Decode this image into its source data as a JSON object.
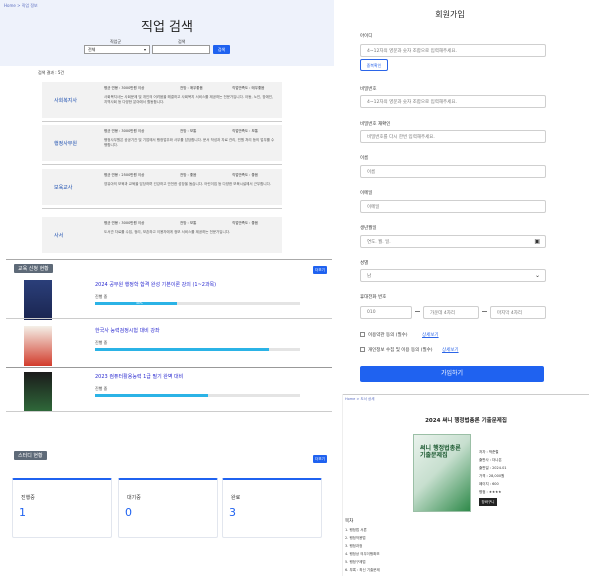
{
  "left": {
    "breadcrumb": "Home > 직업 정보",
    "hero_title": "직업 검색",
    "search": {
      "category_label": "직업군",
      "category_value": "전체",
      "keyword_label": "검색",
      "keyword_placeholder": "",
      "button": "검색"
    },
    "result_count": "검색 결과 : 5건",
    "jobs": [
      {
        "title": "사회복지사",
        "m1": "평균 연봉 : 3000만원 이상",
        "m2": "전망 : 매우좋음",
        "m3": "직업만족도 : 매우좋음",
        "desc": "사회복지사는 사회문제 및 개인의 어려움을 해결하고 사회복지 서비스를 제공하는 전문가입니다. 아동, 노인, 장애인, 지역사회 등 다양한 분야에서 활동합니다."
      },
      {
        "title": "행정사무원",
        "m1": "평균 연봉 : 3000만원 이상",
        "m2": "전망 : 보통",
        "m3": "직업만족도 : 보통",
        "desc": "행정사무원은 공공기관 및 기업에서 행정업무와 사무를 담당합니다. 문서 작성과 자료 관리, 민원 처리 등의 업무를 수행합니다."
      },
      {
        "title": "보육교사",
        "m1": "평균 연봉 : 2500만원 이상",
        "m2": "전망 : 좋음",
        "m3": "직업만족도 : 좋음",
        "desc": "영유아의 보육과 교육을 담당하며 건강하고 안전한 성장을 돕습니다. 어린이집 등 다양한 보육시설에서 근무합니다."
      },
      {
        "title": "사서",
        "m1": "평균 연봉 : 3000만원 이상",
        "m2": "전망 : 보통",
        "m3": "직업만족도 : 좋음",
        "desc": "도서관 자료를 수집, 정리, 보존하고 이용자에게 정보 서비스를 제공하는 전문가입니다."
      }
    ],
    "courses_section": {
      "title": "교육 신청 현황",
      "more": "더보기",
      "items": [
        {
          "title": "2024 공무원 행정학 합격 완성 기본이론 강의 (1~2과목)",
          "meta": "진행 중",
          "progress": 40
        },
        {
          "title": "한국사 능력검정시험 대비 강좌",
          "meta": "진행 중",
          "progress": 80
        },
        {
          "title": "2023 컴퓨터활용능력 1급 필기 완벽 대비",
          "meta": "진행 중",
          "progress": 55
        }
      ]
    },
    "study_section": {
      "title": "스터디 현황",
      "more": "더보기",
      "stats": [
        {
          "label": "진행중",
          "value": "1"
        },
        {
          "label": "대기중",
          "value": "0"
        },
        {
          "label": "완료",
          "value": "3"
        }
      ]
    }
  },
  "signup": {
    "title": "회원가입",
    "fields": [
      {
        "label": "아이디",
        "placeholder": "4~12자의 영문과 숫자 조합으로 입력해주세요."
      },
      {
        "label": "비밀번호",
        "placeholder": "4~12자의 영문과 숫자 조합으로 입력해주세요."
      },
      {
        "label": "비밀번호 재확인",
        "placeholder": "비밀번호를 다시 한번 입력해주세요."
      },
      {
        "label": "이름",
        "placeholder": "이름"
      },
      {
        "label": "이메일",
        "placeholder": "이메일"
      },
      {
        "label": "생년월일",
        "placeholder": "연도. 월. 일."
      },
      {
        "label": "성별",
        "placeholder": "남"
      },
      {
        "label": "휴대전화 번호",
        "placeholder": ""
      }
    ],
    "check_button": "중복확인",
    "phone": {
      "p1": "010",
      "p2": "가운데 4자리",
      "p3": "마지막 4자리"
    },
    "agree1": "이용약관 동의 (필수)",
    "agree1_link": "상세보기",
    "agree2": "개인정보 수집 및 이용 동의 (필수)",
    "agree2_link": "상세보기",
    "submit": "가입하기"
  },
  "book": {
    "breadcrumb": "Home > 도서 상세",
    "title": "2024 써니 행정법총론 기출문제집",
    "cover_text": "써니 행정법총론 기출문제집",
    "info": [
      "저자 : 박준철",
      "출판사 : 더나은",
      "출판일 : 2024.01",
      "가격 : 28,000원",
      "페이지 : 600",
      "평점 : ★★★★"
    ],
    "button": "장바구니",
    "toc_title": "목차",
    "toc": [
      "1. 행정법 서론",
      "2. 행정작용법",
      "3. 행정과정",
      "4. 행정상 의무이행확보",
      "5. 행정구제법",
      "6. 부록 : 최신 기출문제"
    ]
  }
}
